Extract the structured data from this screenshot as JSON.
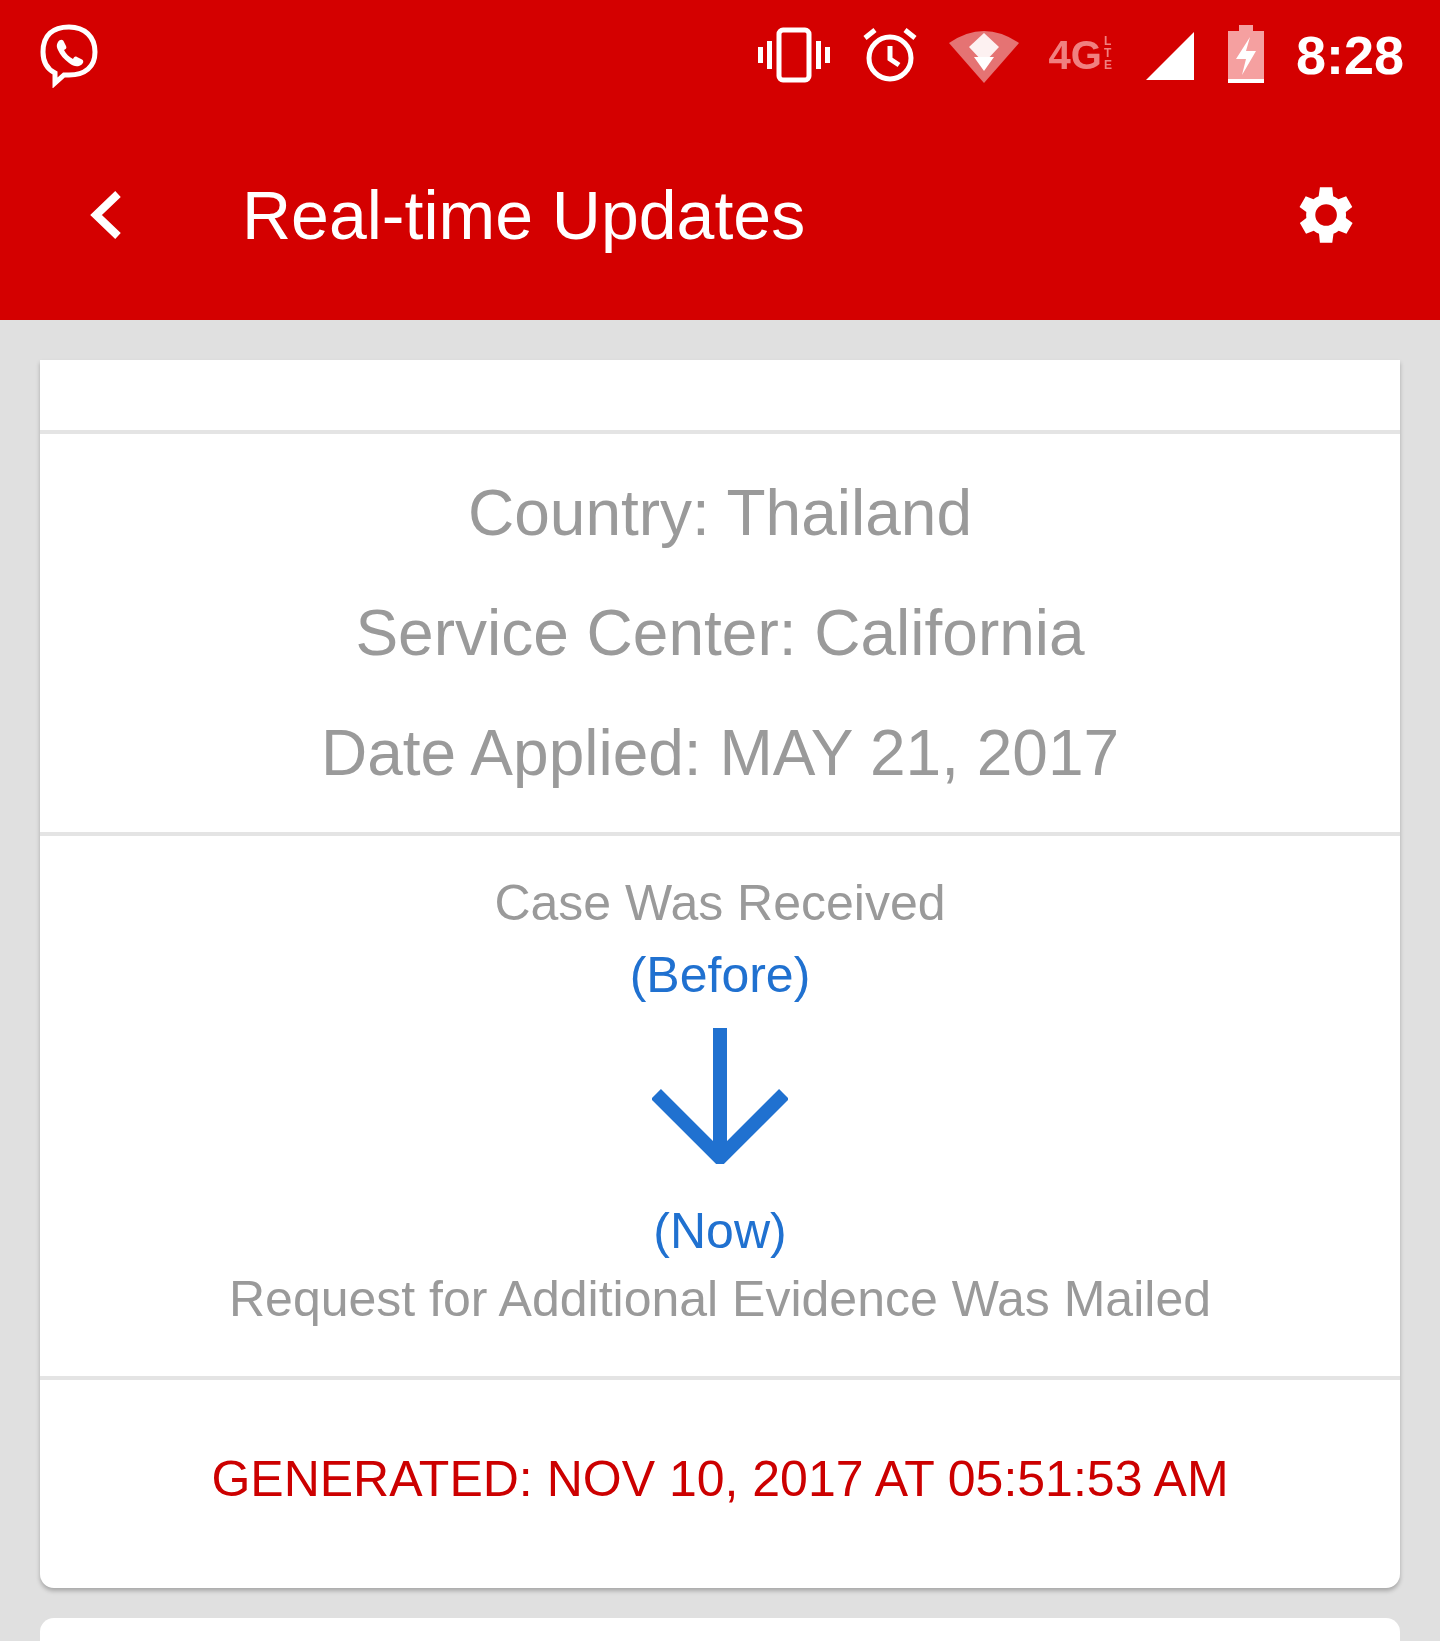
{
  "status_bar": {
    "network": "4G",
    "network_sub": "LTE",
    "time": "8:28"
  },
  "app_bar": {
    "title": "Real-time Updates"
  },
  "case_info": {
    "lines": [
      "Country: Thailand",
      "Service Center: California",
      "Date Applied: MAY 21, 2017"
    ]
  },
  "status_change": {
    "previous_status": "Case Was Received",
    "before_label": "(Before)",
    "now_label": "(Now)",
    "current_status": "Request for Additional Evidence Was Mailed"
  },
  "generated": "GENERATED: NOV 10, 2017 AT 05:51:53 AM"
}
